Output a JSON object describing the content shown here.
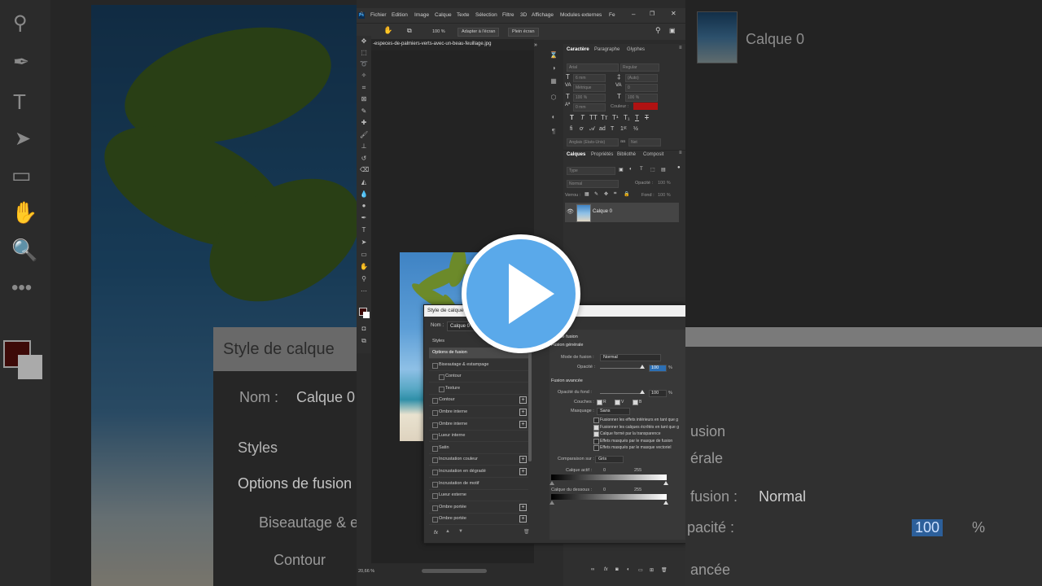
{
  "app": {
    "logo": "Ps",
    "menu": [
      "Fichier",
      "Edition",
      "Image",
      "Calque",
      "Texte",
      "Sélection",
      "Filtre",
      "3D",
      "Affichage",
      "Modules externes",
      "Fe"
    ]
  },
  "options_bar": {
    "zoom": "100 %",
    "fit_screen": "Adapter à l'écran",
    "full_screen": "Plein écran"
  },
  "document": {
    "tab_title": "-especes-de-palmiers-verts-avec-un-beau-feuillage.jpg",
    "zoom_status": "20,66 %"
  },
  "character_panel": {
    "tabs": [
      "Caractère",
      "Paragraphe",
      "Glyphes"
    ],
    "font_family": "Arial",
    "font_style": "Regular",
    "size": "6 mm",
    "leading": "(Auto)",
    "kerning": "Métrique",
    "tracking": "0",
    "vscale": "100 %",
    "hscale": "100 %",
    "baseline": "0 mm",
    "color_label": "Couleur :",
    "color": "#b01212",
    "language": "Anglais (Etats-Unis)",
    "antialias": "Net"
  },
  "layers_panel": {
    "tabs": [
      "Calques",
      "Propriétés",
      "Bibliothè",
      "Composit"
    ],
    "filter_label": "Type",
    "blend_mode": "Normal",
    "opacity_label": "Opacité :",
    "opacity": "100 %",
    "lock_label": "Verrou :",
    "fill_label": "Fond :",
    "fill": "100 %",
    "layer_name": "Calque 0"
  },
  "dialog": {
    "title": "Style de calque",
    "name_label": "Nom :",
    "name_value": "Calque 0",
    "styles_header": "Styles",
    "style_items": [
      {
        "label": "Options de fusion",
        "selected": true,
        "indent": 0,
        "check": false,
        "plus": false
      },
      {
        "label": "Biseautage & estampage",
        "selected": false,
        "indent": 0,
        "check": true,
        "plus": false
      },
      {
        "label": "Contour",
        "selected": false,
        "indent": 1,
        "check": true,
        "plus": false
      },
      {
        "label": "Texture",
        "selected": false,
        "indent": 1,
        "check": true,
        "plus": false
      },
      {
        "label": "Contour",
        "selected": false,
        "indent": 0,
        "check": true,
        "plus": true
      },
      {
        "label": "Ombre interne",
        "selected": false,
        "indent": 0,
        "check": true,
        "plus": true
      },
      {
        "label": "Ombre interne",
        "selected": false,
        "indent": 0,
        "check": true,
        "plus": true
      },
      {
        "label": "Lueur interne",
        "selected": false,
        "indent": 0,
        "check": true,
        "plus": false
      },
      {
        "label": "Satin",
        "selected": false,
        "indent": 0,
        "check": true,
        "plus": false
      },
      {
        "label": "Incrustation couleur",
        "selected": false,
        "indent": 0,
        "check": true,
        "plus": true
      },
      {
        "label": "Incrustation en dégradé",
        "selected": false,
        "indent": 0,
        "check": true,
        "plus": true
      },
      {
        "label": "Incrustation de motif",
        "selected": false,
        "indent": 0,
        "check": true,
        "plus": false
      },
      {
        "label": "Lueur externe",
        "selected": false,
        "indent": 0,
        "check": true,
        "plus": false
      },
      {
        "label": "Ombre portée",
        "selected": false,
        "indent": 0,
        "check": true,
        "plus": true
      },
      {
        "label": "Ombre portée",
        "selected": false,
        "indent": 0,
        "check": true,
        "plus": true
      }
    ],
    "fx_label": "fx",
    "section_fusion": "Options de fusion",
    "section_general": "Fusion générale",
    "blend_mode_label": "Mode de fusion :",
    "blend_mode_value": "Normal",
    "opacity_label": "Opacité :",
    "opacity_value": "100",
    "percent": "%",
    "section_advanced": "Fusion avancée",
    "fill_opacity_label": "Opacité du fond :",
    "fill_opacity_value": "100",
    "channels_label": "Couches :",
    "channels": [
      "R",
      "V",
      "B"
    ],
    "knockout_label": "Masquage :",
    "knockout_value": "Sans",
    "options": [
      {
        "label": "Fusionner les effets intérieurs en tant que g",
        "checked": false
      },
      {
        "label": "Fusionner les calques écrêtés en tant que g",
        "checked": true
      },
      {
        "label": "Calque formé par la transparence",
        "checked": true
      },
      {
        "label": "Effets masqués par le masque de fusion",
        "checked": false
      },
      {
        "label": "Effets masqués par le masque vectoriel",
        "checked": false
      }
    ],
    "compare_label": "Comparaison sur :",
    "compare_value": "Gris",
    "this_layer_label": "Calque actif :",
    "underlying_label": "Calque du dessous :",
    "range_min": "0",
    "range_max": "255"
  },
  "background": {
    "left_dialog_title": "Style de calque",
    "left_name_label": "Nom :",
    "left_name_value": "Calque 0",
    "left_styles": "Styles",
    "left_options": "Options de fusion",
    "left_bevel": "Biseautage & es",
    "left_contour": "Contour",
    "right_layer_name": "Calque 0",
    "right_fusion": "usion",
    "right_general": "érale",
    "right_mode": "fusion :",
    "right_mode_value": "Normal",
    "right_opacity": "pacité :",
    "right_opacity_value": "100",
    "right_percent": "%",
    "right_advanced": "ancée"
  },
  "colors": {
    "accent_blue": "#31a8ff",
    "play_blue": "#5aa9ea",
    "foreground_color": "#3d0a08"
  }
}
